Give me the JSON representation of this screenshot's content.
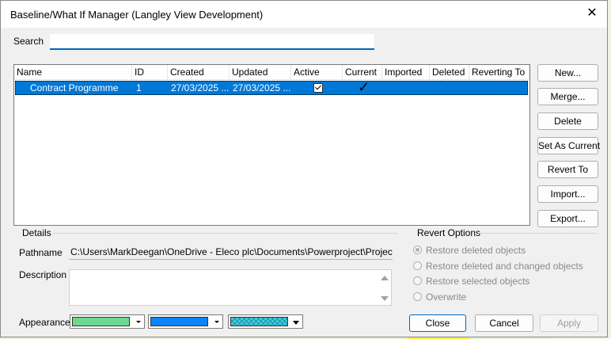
{
  "dialog": {
    "title": "Baseline/What If Manager (Langley View Development)",
    "close_label": "✕"
  },
  "search": {
    "label": "Search",
    "value": ""
  },
  "list": {
    "columns": [
      "Name",
      "ID",
      "Created",
      "Updated",
      "Active",
      "Current",
      "Imported",
      "Deleted",
      "Reverting To"
    ],
    "rows": [
      {
        "name": "Contract Programme",
        "id": "1",
        "created": "27/03/2025 ...",
        "updated": "27/03/2025 ...",
        "active": true,
        "current": "✓",
        "imported": "",
        "deleted": "",
        "reverting_to": ""
      }
    ]
  },
  "side_buttons": {
    "new": "New...",
    "merge": "Merge...",
    "delete": "Delete",
    "set_as_current": "Set As Current",
    "revert_to": "Revert To",
    "import": "Import...",
    "export": "Export..."
  },
  "details": {
    "section_label": "Details",
    "pathname_label": "Pathname",
    "pathname_value": "C:\\Users\\MarkDeegan\\OneDrive - Eleco plc\\Documents\\Powerproject\\Projects\\Langley",
    "description_label": "Description",
    "description_value": "",
    "appearance_label": "Appearance",
    "colors": {
      "fill": "#6dd88f",
      "line": "#0a84ff",
      "pattern_fg": "#1aa0d8",
      "pattern_bg": "#48c8b8"
    }
  },
  "revert_options": {
    "section_label": "Revert Options",
    "options": [
      {
        "label": "Restore deleted objects",
        "checked": true
      },
      {
        "label": "Restore deleted and changed objects",
        "checked": false
      },
      {
        "label": "Restore selected objects",
        "checked": false
      },
      {
        "label": "Overwrite",
        "checked": false
      }
    ]
  },
  "footer_buttons": {
    "close": "Close",
    "cancel": "Cancel",
    "apply": "Apply"
  },
  "theme": {
    "selection": "#0078d7",
    "accent": "#0067c0"
  }
}
